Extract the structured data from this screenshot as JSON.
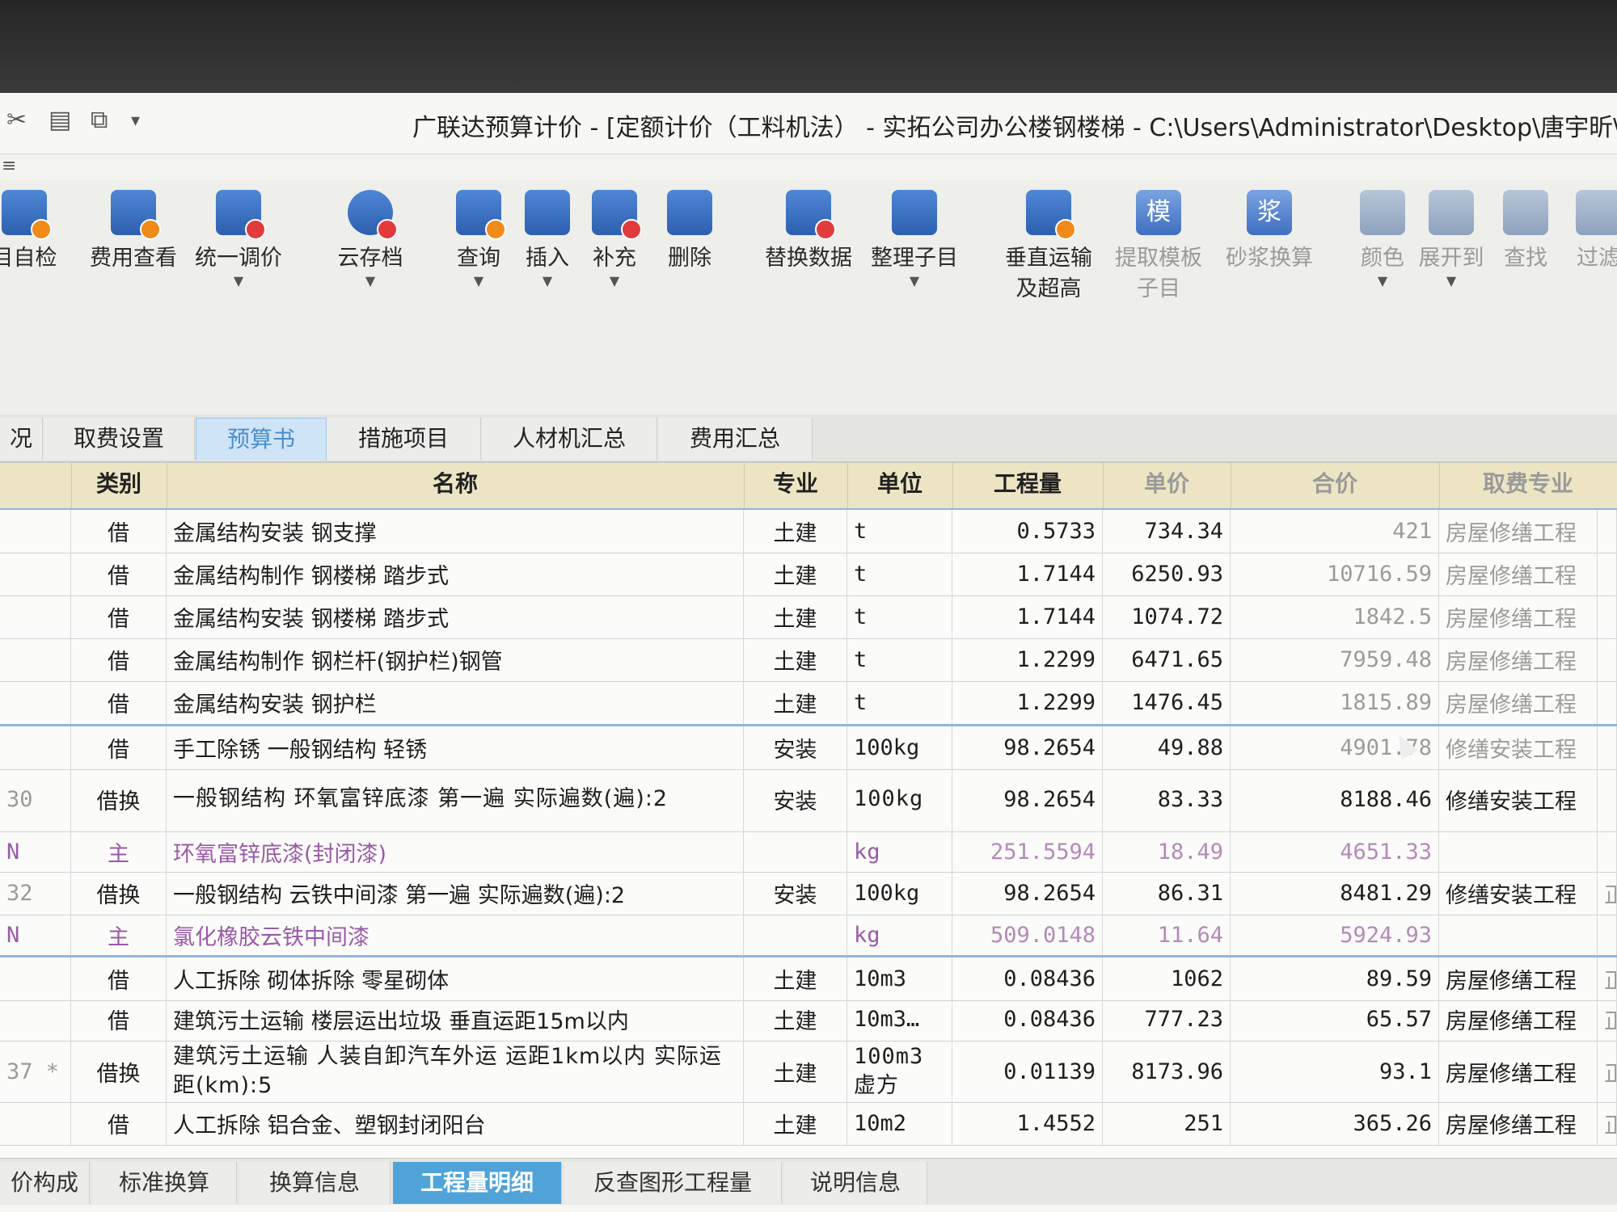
{
  "window": {
    "title": "广联达预算计价 - [定额计价（工料机法） - 实拓公司办公楼钢楼梯 - C:\\Users\\Administrator\\Desktop\\唐宇昕\\工程结",
    "quick_access": [
      "✂",
      "▤",
      "⧉",
      "▾"
    ],
    "menu_stub": "≡"
  },
  "ribbon": {
    "tools": [
      {
        "label": "目自检",
        "icon": "check-doc-icon",
        "dropdown": false,
        "disabled": false
      },
      {
        "label": "费用查看",
        "icon": "fee-view-icon",
        "dropdown": false,
        "disabled": false
      },
      {
        "label": "统一调价",
        "icon": "price-adjust-icon",
        "dropdown": true,
        "disabled": false
      },
      {
        "label": "云存档",
        "icon": "cloud-save-icon",
        "dropdown": true,
        "disabled": false
      },
      {
        "label": "查询",
        "icon": "query-icon",
        "dropdown": true,
        "disabled": false
      },
      {
        "label": "插入",
        "icon": "insert-icon",
        "dropdown": true,
        "disabled": false
      },
      {
        "label": "补充",
        "icon": "supplement-icon",
        "dropdown": true,
        "disabled": false
      },
      {
        "label": "删除",
        "icon": "delete-icon",
        "dropdown": false,
        "disabled": false
      },
      {
        "label": "替换数据",
        "icon": "replace-data-icon",
        "dropdown": false,
        "disabled": false
      },
      {
        "label": "整理子目",
        "icon": "organize-items-icon",
        "dropdown": true,
        "disabled": false
      },
      {
        "label": "垂直运输",
        "label2": "及超高",
        "icon": "vertical-transport-icon",
        "dropdown": true,
        "disabled": false
      },
      {
        "label": "提取模板",
        "label2": "子目",
        "icon": "template-icon",
        "dropdown": false,
        "disabled": true
      },
      {
        "label": "砂浆换算",
        "icon": "mortar-icon",
        "dropdown": false,
        "disabled": true
      },
      {
        "label": "颜色",
        "icon": "color-icon",
        "dropdown": true,
        "disabled": true
      },
      {
        "label": "展开到",
        "icon": "expand-icon",
        "dropdown": true,
        "disabled": true
      },
      {
        "label": "查找",
        "icon": "binoculars-icon",
        "dropdown": false,
        "disabled": true
      },
      {
        "label": "过滤",
        "icon": "filter-icon",
        "dropdown": true,
        "disabled": true
      }
    ]
  },
  "tabs": {
    "items": [
      "况",
      "取费设置",
      "预算书",
      "措施项目",
      "人材机汇总",
      "费用汇总"
    ],
    "active": "预算书"
  },
  "grid": {
    "headers": [
      "类别",
      "名称",
      "专业",
      "单位",
      "工程量",
      "单价",
      "合价",
      "取费专业"
    ],
    "rows": [
      {
        "code": "",
        "type": "借",
        "name": "金属结构安装 钢支撑",
        "major": "土建",
        "unit": "t",
        "qty": "0.5733",
        "price": "734.34",
        "total": "421",
        "fee": "房屋修缮工程",
        "extra": ""
      },
      {
        "code": "",
        "type": "借",
        "name": "金属结构制作 钢楼梯 踏步式",
        "major": "土建",
        "unit": "t",
        "qty": "1.7144",
        "price": "6250.93",
        "total": "10716.59",
        "fee": "房屋修缮工程",
        "extra": ""
      },
      {
        "code": "",
        "type": "借",
        "name": "金属结构安装 钢楼梯 踏步式",
        "major": "土建",
        "unit": "t",
        "qty": "1.7144",
        "price": "1074.72",
        "total": "1842.5",
        "fee": "房屋修缮工程",
        "extra": ""
      },
      {
        "code": "",
        "type": "借",
        "name": "金属结构制作 钢栏杆(钢护栏)钢管",
        "major": "土建",
        "unit": "t",
        "qty": "1.2299",
        "price": "6471.65",
        "total": "7959.48",
        "fee": "房屋修缮工程",
        "extra": ""
      },
      {
        "code": "",
        "type": "借",
        "name": "金属结构安装 钢护栏",
        "major": "土建",
        "unit": "t",
        "qty": "1.2299",
        "price": "1476.45",
        "total": "1815.89",
        "fee": "房屋修缮工程",
        "extra": ""
      },
      {
        "code": "",
        "type": "借",
        "name": "手工除锈 一般钢结构 轻锈",
        "major": "安装",
        "unit": "100kg",
        "qty": "98.2654",
        "price": "49.88",
        "total": "4901.78",
        "fee": "修缮安装工程",
        "extra": ""
      },
      {
        "code": "30",
        "type": "借换",
        "name": "一般钢结构 环氧富锌底漆 第一遍 实际遍数(遍):2",
        "major": "安装",
        "unit": "100kg",
        "qty": "98.2654",
        "price": "83.33",
        "total": "8188.46",
        "fee": "修缮安装工程",
        "extra": ""
      },
      {
        "code": "N",
        "type": "主",
        "name": "环氧富锌底漆(封闭漆)",
        "major": "",
        "unit": "kg",
        "qty": "251.5594",
        "price": "18.49",
        "total": "4651.33",
        "fee": "",
        "extra": ""
      },
      {
        "code": "32",
        "type": "借换",
        "name": "一般钢结构 云铁中间漆 第一遍 实际遍数(遍):2",
        "major": "安装",
        "unit": "100kg",
        "qty": "98.2654",
        "price": "86.31",
        "total": "8481.29",
        "fee": "修缮安装工程",
        "extra": "正"
      },
      {
        "code": "N",
        "type": "主",
        "name": "氯化橡胶云铁中间漆",
        "major": "",
        "unit": "kg",
        "qty": "509.0148",
        "price": "11.64",
        "total": "5924.93",
        "fee": "",
        "extra": ""
      },
      {
        "code": "",
        "type": "借",
        "name": "人工拆除 砌体拆除 零星砌体",
        "major": "土建",
        "unit": "10m3",
        "qty": "0.08436",
        "price": "1062",
        "total": "89.59",
        "fee": "房屋修缮工程",
        "extra": "正"
      },
      {
        "code": "",
        "type": "借",
        "name": "建筑污土运输 楼层运出垃圾 垂直运距15m以内",
        "major": "土建",
        "unit": "10m3…",
        "qty": "0.08436",
        "price": "777.23",
        "total": "65.57",
        "fee": "房屋修缮工程",
        "extra": "正"
      },
      {
        "code": "37 *",
        "type": "借换",
        "name": "建筑污土运输 人装自卸汽车外运 运距1km以内 实际运距(km):5",
        "major": "土建",
        "unit": "100m3虚方",
        "qty": "0.01139",
        "price": "8173.96",
        "total": "93.1",
        "fee": "房屋修缮工程",
        "extra": "正"
      },
      {
        "code": "",
        "type": "借",
        "name": "人工拆除 铝合金、塑钢封闭阳台",
        "major": "土建",
        "unit": "10m2",
        "qty": "1.4552",
        "price": "251",
        "total": "365.26",
        "fee": "房屋修缮工程",
        "extra": "正"
      }
    ]
  },
  "bottom_tabs": {
    "items": [
      "价构成",
      "标准换算",
      "换算信息",
      "工程量明细",
      "反查图形工程量",
      "说明信息"
    ],
    "active": "工程量明细"
  }
}
